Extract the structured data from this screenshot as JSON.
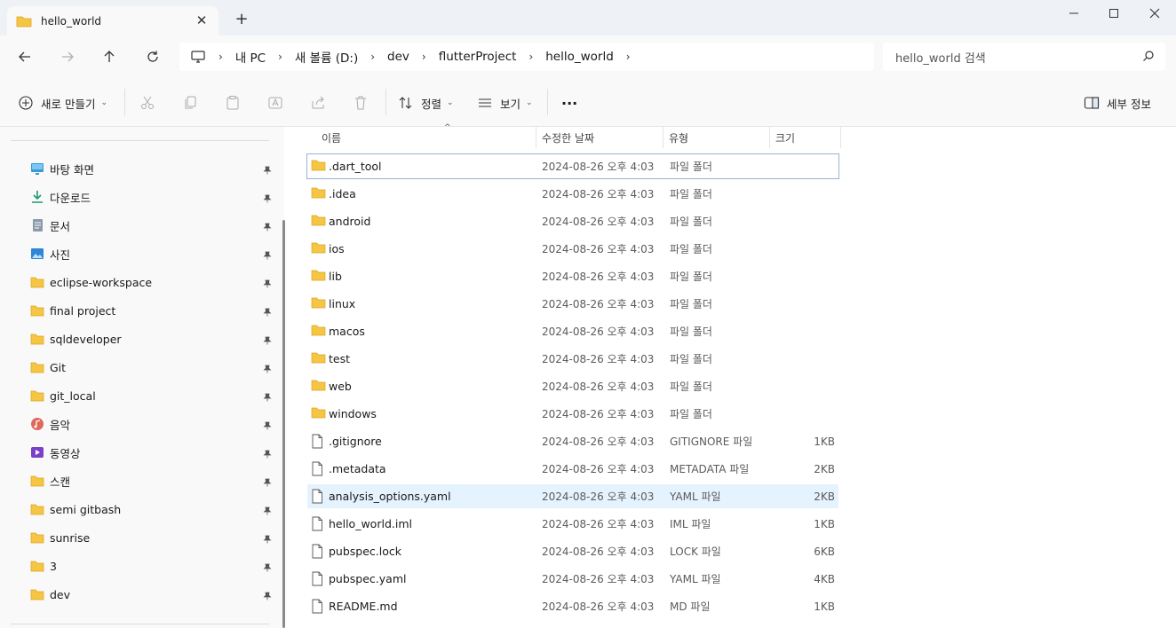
{
  "window": {
    "tab_title": "hello_world",
    "tab_close": "✕",
    "new_tab": "+"
  },
  "nav": {
    "breadcrumb": [
      "내 PC",
      "새 볼륨 (D:)",
      "dev",
      "flutterProject",
      "hello_world"
    ],
    "search_placeholder": "hello_world 검색"
  },
  "toolbar": {
    "new_label": "새로 만들기",
    "sort_label": "정렬",
    "view_label": "보기",
    "more_label": "···",
    "details_label": "세부 정보"
  },
  "sidebar": {
    "items": [
      {
        "label": "바탕 화면",
        "icon": "desktop-icon"
      },
      {
        "label": "다운로드",
        "icon": "download-icon"
      },
      {
        "label": "문서",
        "icon": "document-icon"
      },
      {
        "label": "사진",
        "icon": "pictures-icon"
      },
      {
        "label": "eclipse-workspace",
        "icon": "folder-icon"
      },
      {
        "label": "final project",
        "icon": "folder-icon"
      },
      {
        "label": "sqldeveloper",
        "icon": "folder-icon"
      },
      {
        "label": "Git",
        "icon": "folder-icon"
      },
      {
        "label": "git_local",
        "icon": "folder-icon"
      },
      {
        "label": "음악",
        "icon": "music-icon"
      },
      {
        "label": "동영상",
        "icon": "video-icon"
      },
      {
        "label": "스캔",
        "icon": "folder-icon"
      },
      {
        "label": "semi gitbash",
        "icon": "folder-icon"
      },
      {
        "label": "sunrise",
        "icon": "folder-icon"
      },
      {
        "label": "3",
        "icon": "folder-icon"
      },
      {
        "label": "dev",
        "icon": "folder-icon"
      }
    ]
  },
  "columns": {
    "name": "이름",
    "modified": "수정한 날짜",
    "type": "유형",
    "size": "크기"
  },
  "files": [
    {
      "name": ".dart_tool",
      "date": "2024-08-26 오후 4:03",
      "type": "파일 폴더",
      "size": "",
      "kind": "folder"
    },
    {
      "name": ".idea",
      "date": "2024-08-26 오후 4:03",
      "type": "파일 폴더",
      "size": "",
      "kind": "folder"
    },
    {
      "name": "android",
      "date": "2024-08-26 오후 4:03",
      "type": "파일 폴더",
      "size": "",
      "kind": "folder"
    },
    {
      "name": "ios",
      "date": "2024-08-26 오후 4:03",
      "type": "파일 폴더",
      "size": "",
      "kind": "folder"
    },
    {
      "name": "lib",
      "date": "2024-08-26 오후 4:03",
      "type": "파일 폴더",
      "size": "",
      "kind": "folder"
    },
    {
      "name": "linux",
      "date": "2024-08-26 오후 4:03",
      "type": "파일 폴더",
      "size": "",
      "kind": "folder"
    },
    {
      "name": "macos",
      "date": "2024-08-26 오후 4:03",
      "type": "파일 폴더",
      "size": "",
      "kind": "folder"
    },
    {
      "name": "test",
      "date": "2024-08-26 오후 4:03",
      "type": "파일 폴더",
      "size": "",
      "kind": "folder"
    },
    {
      "name": "web",
      "date": "2024-08-26 오후 4:03",
      "type": "파일 폴더",
      "size": "",
      "kind": "folder"
    },
    {
      "name": "windows",
      "date": "2024-08-26 오후 4:03",
      "type": "파일 폴더",
      "size": "",
      "kind": "folder"
    },
    {
      "name": ".gitignore",
      "date": "2024-08-26 오후 4:03",
      "type": "GITIGNORE 파일",
      "size": "1KB",
      "kind": "file"
    },
    {
      "name": ".metadata",
      "date": "2024-08-26 오후 4:03",
      "type": "METADATA 파일",
      "size": "2KB",
      "kind": "file"
    },
    {
      "name": "analysis_options.yaml",
      "date": "2024-08-26 오후 4:03",
      "type": "YAML 파일",
      "size": "2KB",
      "kind": "file"
    },
    {
      "name": "hello_world.iml",
      "date": "2024-08-26 오후 4:03",
      "type": "IML 파일",
      "size": "1KB",
      "kind": "file"
    },
    {
      "name": "pubspec.lock",
      "date": "2024-08-26 오후 4:03",
      "type": "LOCK 파일",
      "size": "6KB",
      "kind": "file"
    },
    {
      "name": "pubspec.yaml",
      "date": "2024-08-26 오후 4:03",
      "type": "YAML 파일",
      "size": "4KB",
      "kind": "file"
    },
    {
      "name": "README.md",
      "date": "2024-08-26 오후 4:03",
      "type": "MD 파일",
      "size": "1KB",
      "kind": "file"
    }
  ],
  "colors": {
    "folder": "#f6c544",
    "hover_row": "#e5f3ff",
    "focus_outline": "#9ab4d6"
  }
}
